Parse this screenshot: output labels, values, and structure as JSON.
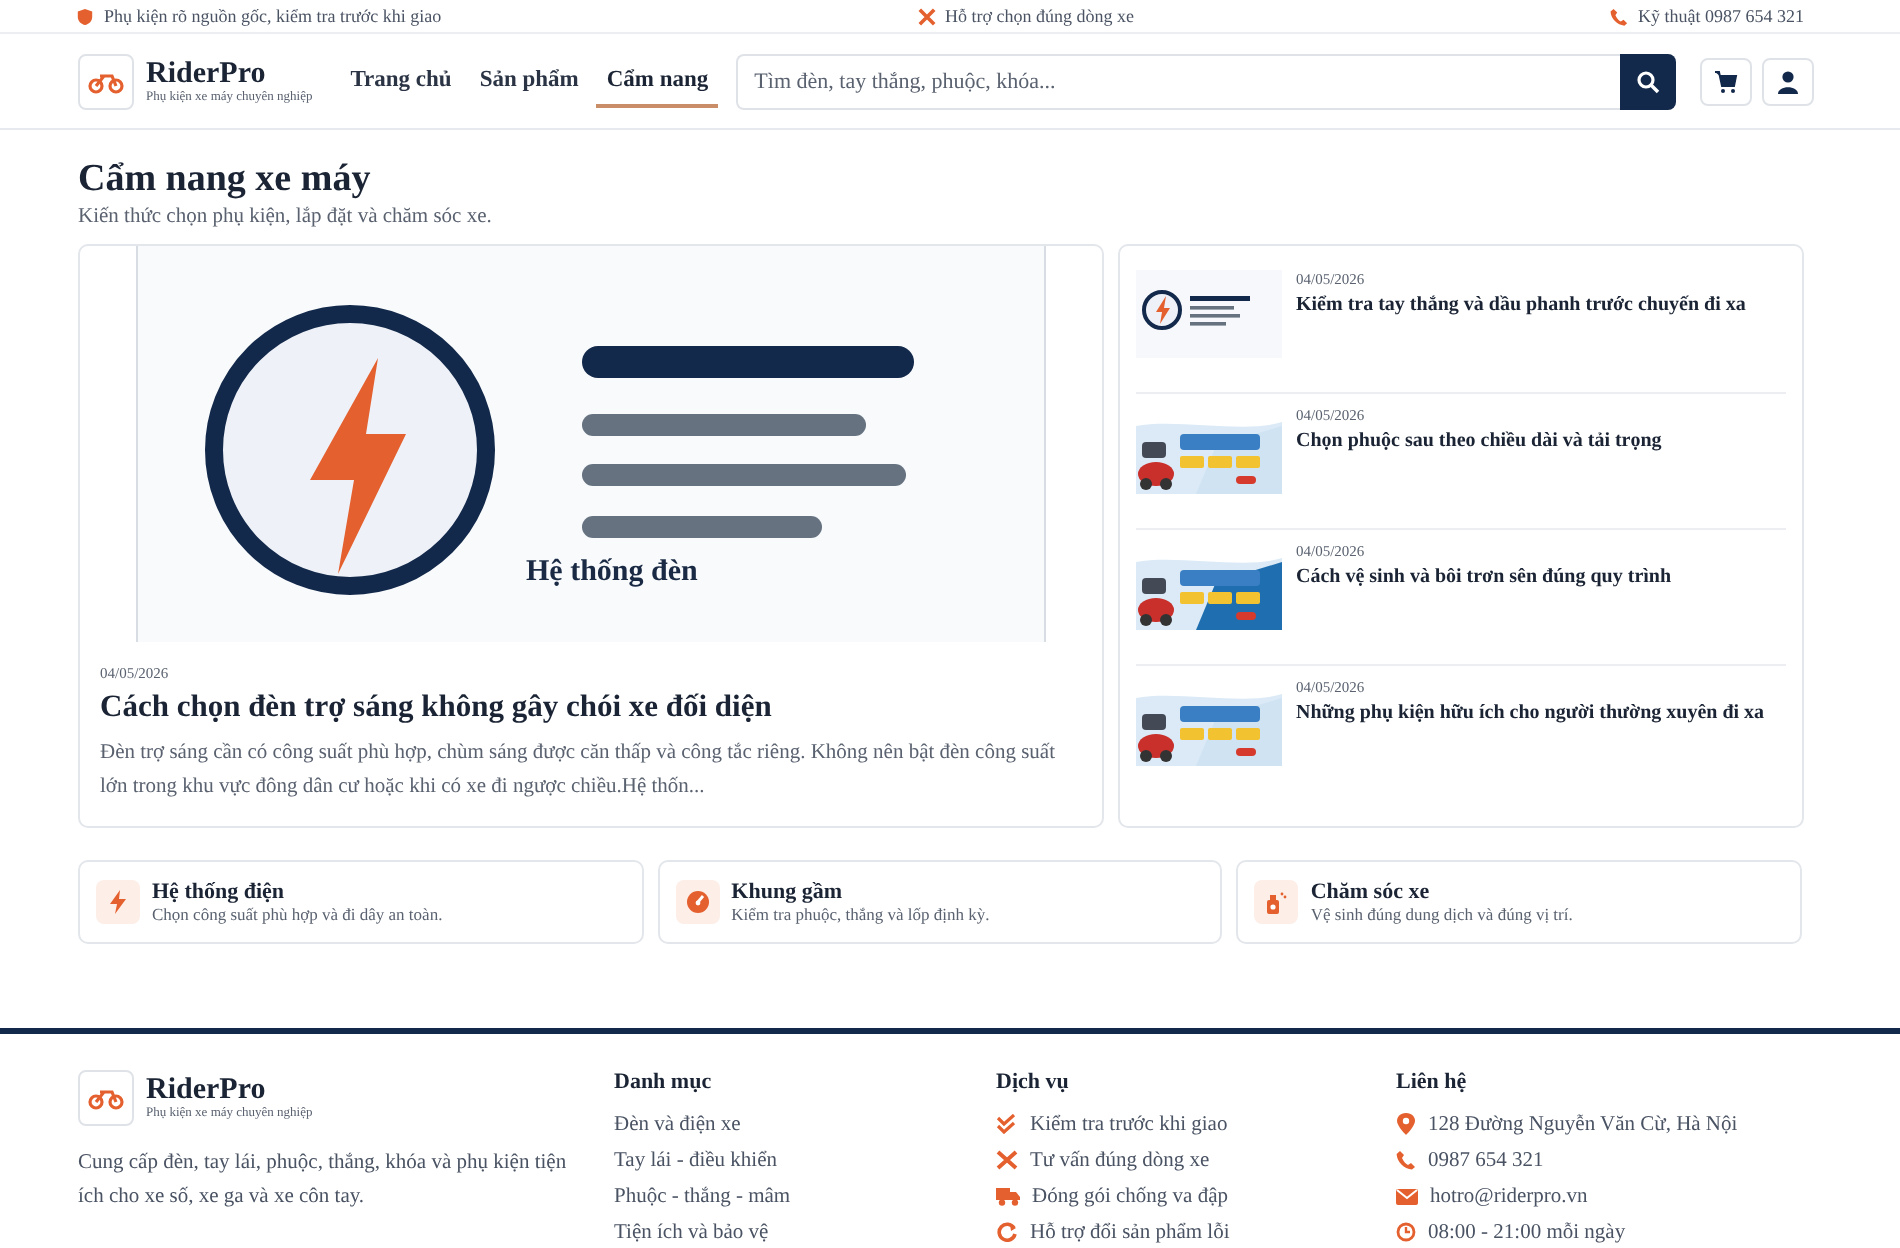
{
  "top_bar": [
    "Phụ kiện rõ nguồn gốc, kiểm tra trước khi giao",
    "Hỗ trợ chọn đúng dòng xe",
    "Kỹ thuật 0987 654 321"
  ],
  "brand": {
    "name": "RiderPro",
    "tagline": "Phụ kiện xe máy chuyên nghiệp"
  },
  "nav": [
    {
      "label": "Trang chủ",
      "selected": false
    },
    {
      "label": "Sản phẩm",
      "selected": false
    },
    {
      "label": "Cẩm nang",
      "selected": true
    }
  ],
  "search": {
    "placeholder": "Tìm đèn, tay thắng, phuộc, khóa..."
  },
  "page": {
    "title": "Cẩm nang xe máy",
    "subtitle": "Kiến thức chọn phụ kiện, lắp đặt và chăm sóc xe."
  },
  "featured": {
    "image_caption": "Hệ thống đèn",
    "date": "04/05/2026",
    "title": "Cách chọn đèn trợ sáng không gây chói xe đối diện",
    "excerpt": "Đèn trợ sáng cần có công suất phù hợp, chùm sáng được căn thấp và công tắc riêng. Không nên bật đèn công suất lớn trong khu vực đông dân cư hoặc khi có xe đi ngược chiều.Hệ thốn..."
  },
  "articles": [
    {
      "kind": "illustration",
      "date": "04/05/2026",
      "title": "Kiểm tra tay thắng và dầu phanh trước chuyến đi xa"
    },
    {
      "kind": "picture",
      "date": "04/05/2026",
      "title": "Chọn phuộc sau theo chiều dài và tải trọng"
    },
    {
      "kind": "picture",
      "date": "04/05/2026",
      "title": "Cách vệ sinh và bôi trơn sên đúng quy trình"
    },
    {
      "kind": "picture",
      "date": "04/05/2026",
      "title": "Những phụ kiện hữu ích cho người thường xuyên đi xa"
    }
  ],
  "categories": [
    {
      "title": "Hệ thống điện",
      "text": "Chọn công suất phù hợp và đi dây an toàn."
    },
    {
      "title": "Khung gầm",
      "text": "Kiểm tra phuộc, thắng và lốp định kỳ."
    },
    {
      "title": "Chăm sóc xe",
      "text": "Vệ sinh đúng dung dịch và đúng vị trí."
    }
  ],
  "footer": {
    "brand_name": "RiderPro",
    "brand_tagline": "Phụ kiện xe máy chuyên nghiệp",
    "about": "Cung cấp đèn, tay lái, phuộc, thắng, khóa và phụ kiện tiện ích cho xe số, xe ga và xe côn tay.",
    "columns": [
      {
        "title": "Danh mục",
        "items": [
          "Đèn và điện xe",
          "Tay lái - điều khiển",
          "Phuộc - thắng - mâm",
          "Tiện ích và bảo vệ"
        ]
      },
      {
        "title": "Dịch vụ",
        "items": [
          "Kiểm tra trước khi giao",
          "Tư vấn đúng dòng xe",
          "Đóng gói chống va đập",
          "Hỗ trợ đổi sản phẩm lỗi"
        ]
      },
      {
        "title": "Liên hệ",
        "items": [
          "128 Đường Nguyễn Văn Cừ, Hà Nội",
          "0987 654 321",
          "hotro@riderpro.vn",
          "08:00 - 21:00 mỗi ngày"
        ]
      }
    ]
  }
}
